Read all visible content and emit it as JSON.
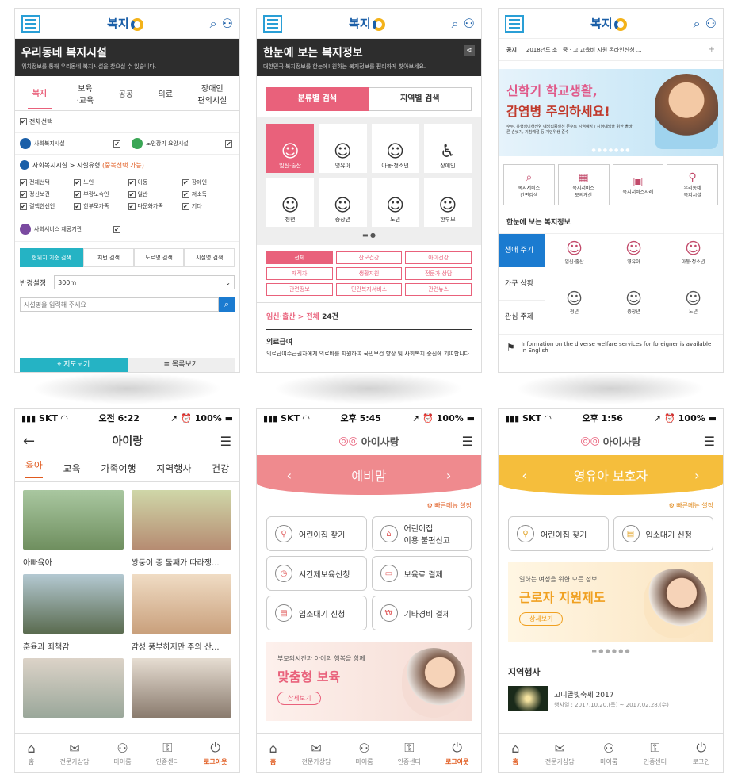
{
  "p1": {
    "title": "우리동네 복지시설",
    "subtitle": "위치정보를 통해 우리동네 복지시설을 찾으실 수 있습니다.",
    "tabs": [
      "복지",
      "보육\n·교육",
      "공공",
      "의료",
      "장애인\n편의시설"
    ],
    "all": "전체선택",
    "facA": "사회복지시설",
    "facB": "노인장기 요양시설",
    "typeLabel": "사회복지시설 > 시설유형",
    "typeNote": "(중복선택 가능)",
    "types": [
      "전체선택",
      "노인",
      "아동",
      "장애인",
      "정신보건",
      "부랑노숙인",
      "일반",
      "저소득",
      "결핵한센인",
      "한부모가족",
      "다문화가족",
      "기타"
    ],
    "service": "사회서비스 제공기관",
    "searchTabs": [
      "현위치 기준 검색",
      "지번 검색",
      "도로명 검색",
      "시설명 검색"
    ],
    "radiusLabel": "반경설정",
    "radius": "300m",
    "inputPh": "시설명을 입력해 주세요",
    "mapBtn": "지도보기",
    "listBtn": "목록보기"
  },
  "p2": {
    "title": "한눈에 보는 복지정보",
    "subtitle": "대한민국 복지정보를 한눈에! 원하는 복지정보를 편리하게 찾아보세요.",
    "tab1": "분류별 검색",
    "tab2": "지역별 검색",
    "cats": [
      "임신·출산",
      "영유아",
      "아동·청소년",
      "장애인",
      "청년",
      "중장년",
      "노년",
      "한부모"
    ],
    "tags": [
      "전체",
      "산모건강",
      "아이건강",
      "재직자",
      "생활지원",
      "전문가 상담",
      "관련정보",
      "민간복지서비스",
      "관련뉴스"
    ],
    "crumb": "임신·출산 > 전체",
    "count": "24건",
    "itemTitle": "의료급여",
    "itemDesc": "의료급여수급권자에게 의료비를 지원하여 국민보건 향상 및 사회복지 증진에 기여합니다."
  },
  "p3": {
    "noticeLabel": "공지",
    "notice": "2018년도 초 · 중 · 고 교육비 지원 온라인신청 ...",
    "bannerL1": "신학기 학교생활,",
    "bannerL2": "감염병 주의하세요!",
    "bannerSmall": "수두, 유행성이하선염 예방접종실천 준수로 감염예방 / 감염예방을 위한 올바른 손씻기, 기침예절 등 개인위생 준수",
    "quick": [
      "복지서비스\n간편검색",
      "복지서비스\n모의계산",
      "복지서비스사례",
      "우리동네\n복지시설"
    ],
    "sectionTitle": "한눈에 보는 복지정보",
    "side": [
      "생애 주기",
      "가구 상황",
      "관심 주제"
    ],
    "cats": [
      "임신·출산",
      "영유아",
      "아동·청소년",
      "청년",
      "중장년",
      "노년"
    ],
    "footer": "Information on the diverse welfare services for foreigner is available in English"
  },
  "p4": {
    "carrier": "SKT",
    "time": "오전 6:22",
    "battery": "100%",
    "title": "아이랑",
    "tabs": [
      "육아",
      "교육",
      "가족여행",
      "지역행사",
      "건강"
    ],
    "cards": [
      "아빠육아",
      "쌍둥이 중 둘째가 따라쟁...",
      "훈육과 죄책감",
      "감성 풍부하지만 주의 산...",
      "",
      ""
    ]
  },
  "p5": {
    "carrier": "SKT",
    "time": "오후 5:45",
    "battery": "100%",
    "appName": "아이사랑",
    "header": "예비맘",
    "quick": "빠른메뉴 설정",
    "menu": [
      "어린이집 찾기",
      "어린이집\n이용 불편신고",
      "시간제보육신청",
      "보육료 결제",
      "입소대기 신청",
      "기타경비 결제"
    ],
    "bannerSmall": "부모의시간과 아이의 행복을 함께",
    "bannerBig": "맞춤형 보육",
    "more": "상세보기"
  },
  "p6": {
    "carrier": "SKT",
    "time": "오후 1:56",
    "battery": "100%",
    "appName": "아이사랑",
    "header": "영유아 보호자",
    "quick": "빠른메뉴 설정",
    "menu": [
      "어린이집 찾기",
      "입소대기 신청"
    ],
    "bannerSmall": "일하는 여성을 위한 모든 정보",
    "bannerBig": "근로자 지원제도",
    "more": "상세보기",
    "eventTitle": "지역행사",
    "eventName": "고니골빛축제 2017",
    "eventDate": "행사일 : 2017.10.20.(목) ~ 2017.02.28.(수)"
  },
  "tabs4": [
    "홈",
    "전문가상담",
    "마이룸",
    "인증센터",
    "로그아웃"
  ],
  "tabs6": [
    "홈",
    "전문가상담",
    "마이룸",
    "인증센터",
    "로그인"
  ]
}
